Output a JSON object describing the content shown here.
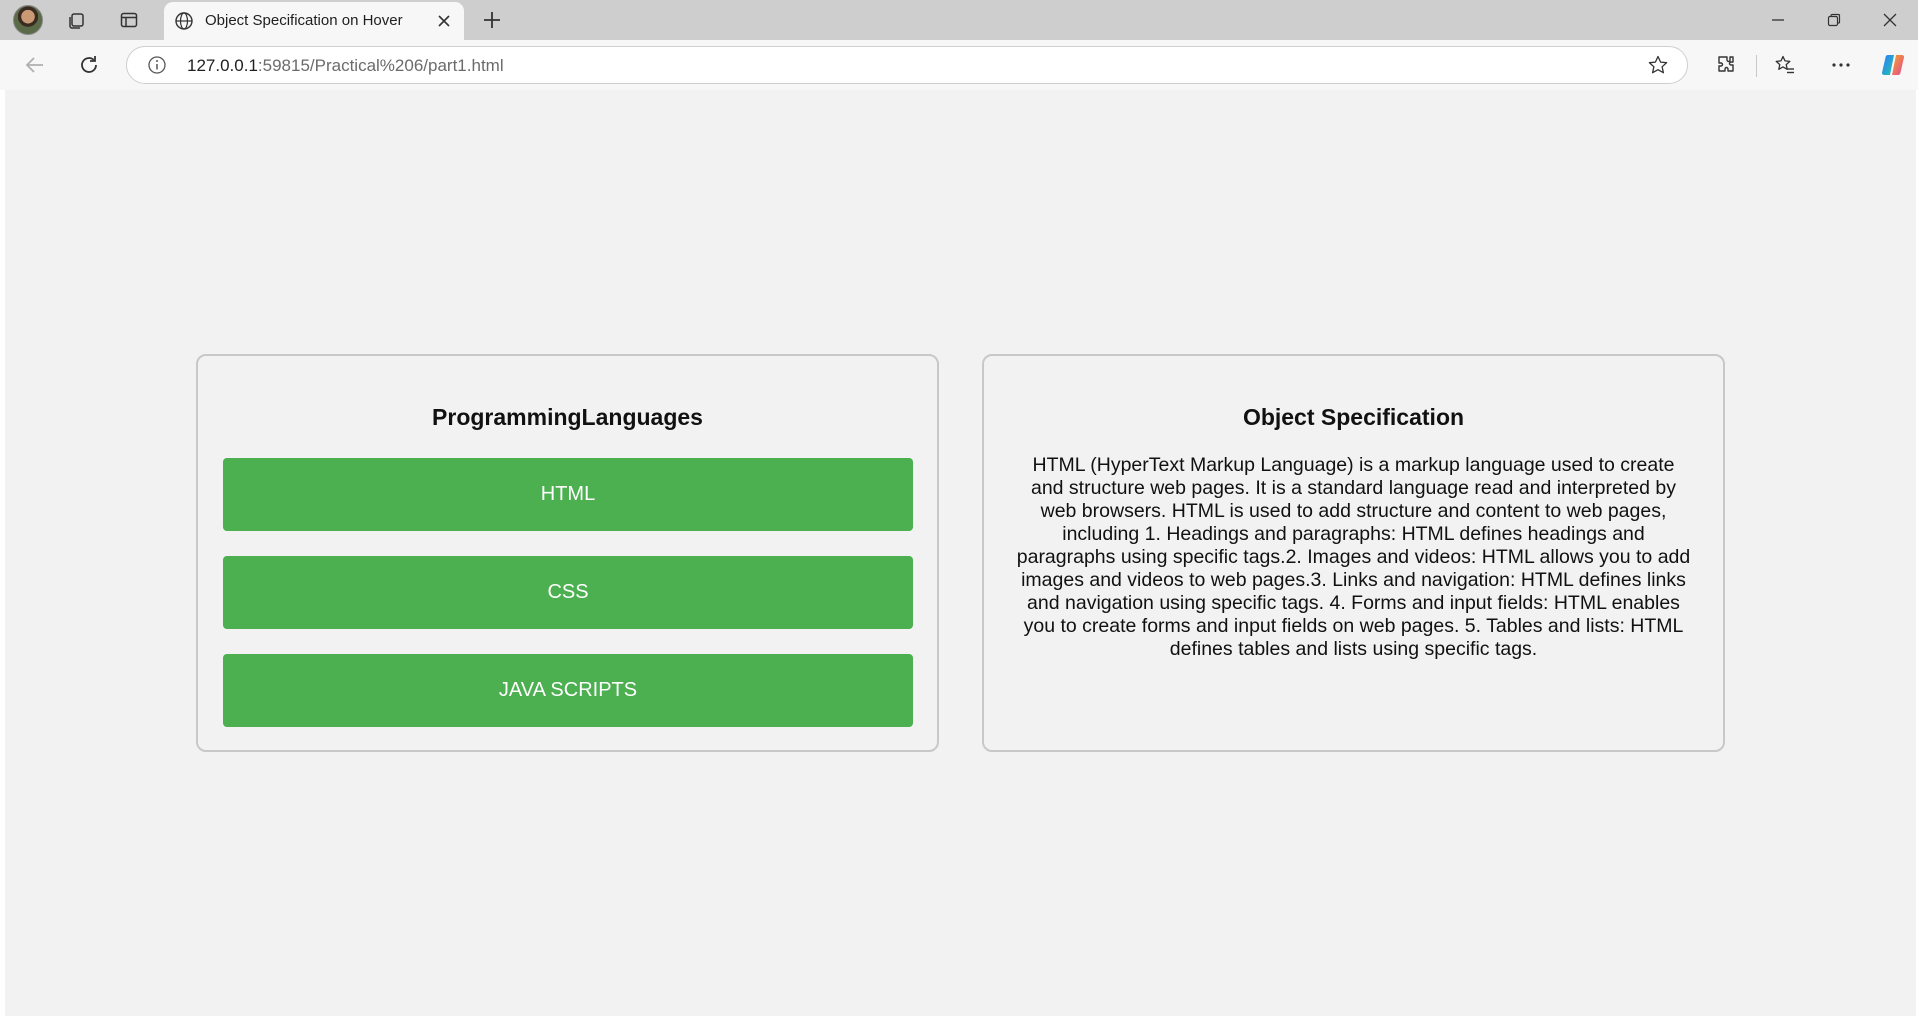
{
  "browser": {
    "tab_title": "Object Specification on Hover",
    "url_host": "127.0.0.1",
    "url_rest": ":59815/Practical%206/part1.html"
  },
  "page": {
    "left_card": {
      "heading": "ProgrammingLanguages",
      "buttons": [
        "HTML",
        "CSS",
        "JAVA SCRIPTS"
      ]
    },
    "right_card": {
      "heading": "Object Specification",
      "description": "HTML (HyperText Markup Language) is a markup language used to create and structure web pages. It is a standard language read and interpreted by web browsers. HTML is used to add structure and content to web pages, including 1. Headings and paragraphs: HTML defines headings and paragraphs using specific tags.2. Images and videos: HTML allows you to add images and videos to web pages.3. Links and navigation: HTML defines links and navigation using specific tags. 4. Forms and input fields: HTML enables you to create forms and input fields on web pages. 5. Tables and lists: HTML defines tables and lists using specific tags."
    },
    "colors": {
      "button_bg": "#4caf50",
      "page_bg": "#f2f2f2",
      "card_border": "#c8c8c8"
    }
  }
}
